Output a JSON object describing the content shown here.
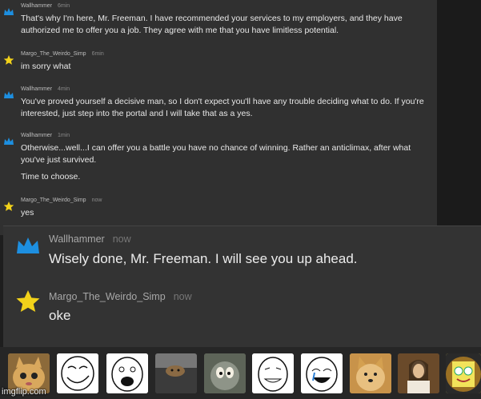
{
  "top_messages": [
    {
      "author": "Wallhammer",
      "time": "6min",
      "avatar_icon": "crown-icon",
      "lines": [
        "That's why I'm here, Mr. Freeman. I have recommended your services to my employers, and they have authorized me to offer you a job. They agree with me that you have limitless potential."
      ]
    },
    {
      "author": "Margo_The_Weirdo_Simp",
      "time": "6min",
      "avatar_icon": "star-icon",
      "lines": [
        "im sorry what"
      ]
    },
    {
      "author": "Wallhammer",
      "time": "4min",
      "avatar_icon": "crown-icon",
      "lines": [
        "You've proved yourself a decisive man, so I don't expect you'll have any trouble deciding what to do. If you're interested, just step into the portal and I will take that as a yes."
      ]
    },
    {
      "author": "Wallhammer",
      "time": "1min",
      "avatar_icon": "crown-icon",
      "lines": [
        "Otherwise...well...I can offer you a battle you have no chance of winning. Rather an anticlimax, after what you've just survived.",
        "Time to choose."
      ]
    },
    {
      "author": "Margo_The_Weirdo_Simp",
      "time": "now",
      "avatar_icon": "star-icon",
      "lines": [
        "yes"
      ]
    }
  ],
  "bottom_messages": [
    {
      "author": "Wallhammer",
      "time": "now",
      "avatar_icon": "crown-icon",
      "text": "Wisely done, Mr. Freeman. I will see you up ahead."
    },
    {
      "author": "Margo_The_Weirdo_Simp",
      "time": "now",
      "avatar_icon": "star-icon",
      "text": "oke"
    }
  ],
  "stickers": [
    {
      "name": "cat-sticker"
    },
    {
      "name": "troll-face-sticker"
    },
    {
      "name": "lol-face-sticker"
    },
    {
      "name": "hamster-sticker"
    },
    {
      "name": "tom-cat-sticker"
    },
    {
      "name": "rage-face-sticker"
    },
    {
      "name": "crying-face-sticker"
    },
    {
      "name": "doge-sticker"
    },
    {
      "name": "jesus-sticker"
    },
    {
      "name": "spongebob-sticker"
    }
  ],
  "colors": {
    "crown": "#1d8fe0",
    "star": "#f2d21a",
    "background": "#303030"
  },
  "watermark": "imgflip.com"
}
